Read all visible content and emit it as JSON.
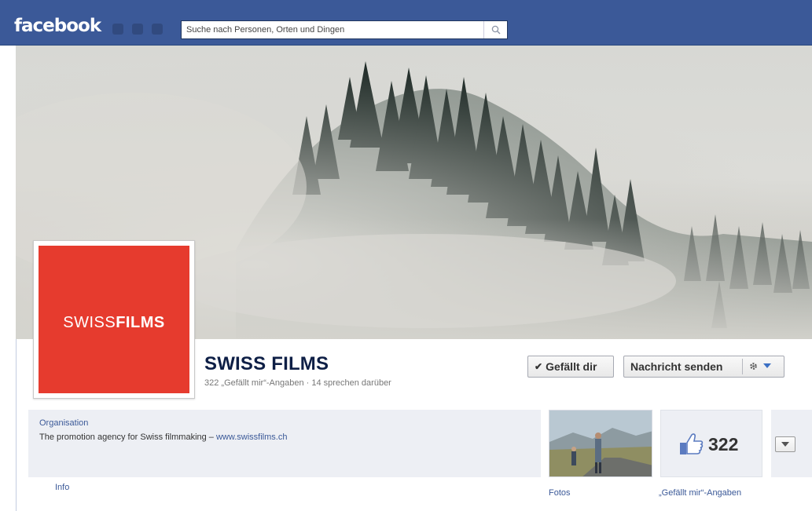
{
  "topbar": {
    "brand": "facebook",
    "search_placeholder": "Suche nach Personen, Orten und Dingen",
    "brand_color": "#3b5998"
  },
  "page": {
    "name": "SWISS FILMS",
    "stats": "322 „Gefällt mir“-Angaben · 14 sprechen darüber",
    "logo_light": "SWISS",
    "logo_bold": "FILMS",
    "logo_color": "#e63b2e"
  },
  "actions": {
    "like_label": "Gefällt dir",
    "message_label": "Nachricht senden",
    "settings_icon": "gear-icon"
  },
  "about": {
    "category": "Organisation",
    "description": "The promotion agency for Swiss filmmaking – ",
    "website": "www.swissfilms.ch",
    "info_link": "Info"
  },
  "apps": [
    {
      "label": "Fotos",
      "icon": "photo-thumbnail"
    },
    {
      "label": "„Gefällt mir“-Angaben",
      "count": "322",
      "icon": "thumbs-up-icon"
    }
  ]
}
